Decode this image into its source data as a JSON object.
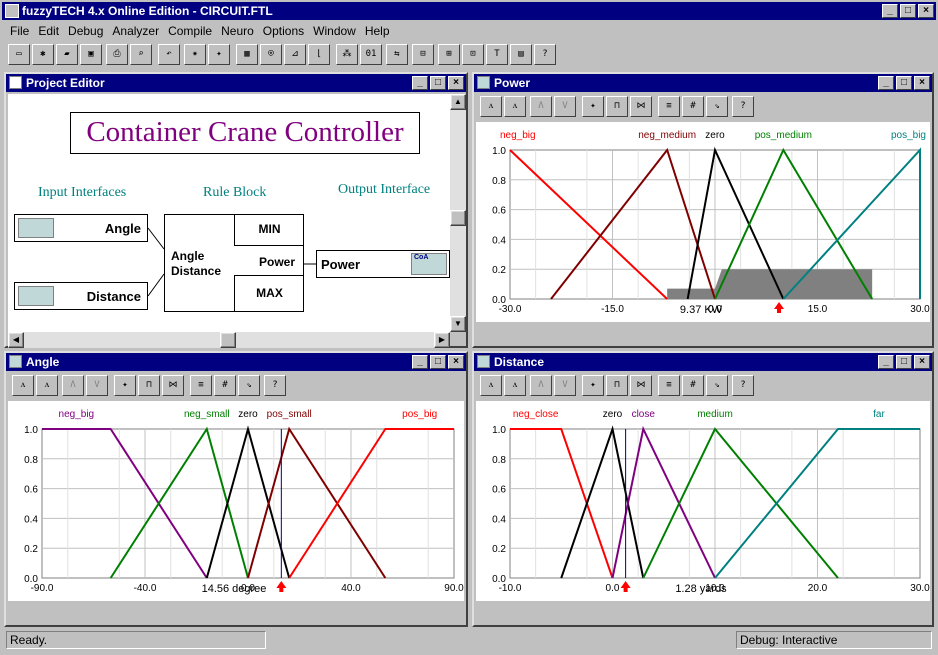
{
  "app": {
    "title": "fuzzyTECH 4.x Online Edition - CIRCUIT.FTL"
  },
  "menu": [
    "File",
    "Edit",
    "Debug",
    "Analyzer",
    "Compile",
    "Neuro",
    "Options",
    "Window",
    "Help"
  ],
  "toolbar_icons": [
    "new-file-icon",
    "open-wizard-icon",
    "open-folder-icon",
    "save-icon",
    "print-icon",
    "print-preview-icon",
    "undo-icon",
    "debug-icon",
    "analyzer-icon",
    "rule-block-icon",
    "variable-icon",
    "membership-icon",
    "transfer-plot-icon",
    "compile-icon",
    "binary-icon",
    "neuro-icon",
    "link-icon",
    "grid1-icon",
    "grid2-icon",
    "grid3-icon",
    "text-icon",
    "window-icon",
    "help-icon"
  ],
  "project_editor": {
    "title": "Project Editor",
    "heading": "Container Crane Controller",
    "input_label": "Input Interfaces",
    "rule_label": "Rule Block",
    "output_label": "Output Interface",
    "inputs": [
      "Angle",
      "Distance"
    ],
    "rule_inputs": [
      "Angle",
      "Distance"
    ],
    "aggregation": "MIN",
    "rule_output": "Power",
    "result_agg": "MAX",
    "output": "Power",
    "coa_label": "CoA"
  },
  "power": {
    "title": "Power",
    "unit_value": "9.37 KW",
    "chart": {
      "type": "line",
      "xlim": [
        -30,
        30
      ],
      "ylim": [
        0,
        1
      ],
      "xticks": [
        "-30.0",
        "-15.0",
        "0.0",
        "15.0",
        "30.0"
      ],
      "yticks": [
        "1.0",
        "0.8",
        "0.6",
        "0.4",
        "0.2",
        "0.0"
      ],
      "terms": [
        {
          "name": "neg_big",
          "color": "#ff0000",
          "points": [
            [
              -30,
              1
            ],
            [
              -7,
              0
            ]
          ]
        },
        {
          "name": "neg_medium",
          "color": "#800000",
          "points": [
            [
              -24,
              0
            ],
            [
              -7,
              1
            ],
            [
              0,
              0
            ]
          ]
        },
        {
          "name": "zero",
          "color": "#000000",
          "points": [
            [
              -4,
              0
            ],
            [
              0,
              1
            ],
            [
              10,
              0
            ]
          ]
        },
        {
          "name": "pos_medium",
          "color": "#008000",
          "points": [
            [
              0,
              0
            ],
            [
              10,
              1
            ],
            [
              23,
              0
            ]
          ]
        },
        {
          "name": "pos_big",
          "color": "#008080",
          "points": [
            [
              10,
              0
            ],
            [
              30,
              1
            ],
            [
              30,
              0
            ]
          ]
        }
      ],
      "fill": [
        [
          -7,
          0
        ],
        [
          -7,
          0.07
        ],
        [
          0,
          0.07
        ],
        [
          1,
          0.2
        ],
        [
          23,
          0.2
        ],
        [
          23,
          0
        ]
      ],
      "crisp": 9.37
    }
  },
  "angle": {
    "title": "Angle",
    "unit_value": "14.56 degree",
    "chart": {
      "type": "line",
      "xlim": [
        -90,
        90
      ],
      "ylim": [
        0,
        1
      ],
      "xticks": [
        "-90.0",
        "-40.0",
        "0.0",
        "40.0",
        "90.0"
      ],
      "yticks": [
        "1.0",
        "0.8",
        "0.6",
        "0.4",
        "0.2",
        "0.0"
      ],
      "terms": [
        {
          "name": "neg_big",
          "color": "#800080",
          "points": [
            [
              -90,
              1
            ],
            [
              -60,
              1
            ],
            [
              -18,
              0
            ]
          ]
        },
        {
          "name": "neg_small",
          "color": "#008000",
          "points": [
            [
              -60,
              0
            ],
            [
              -18,
              1
            ],
            [
              0,
              0
            ]
          ]
        },
        {
          "name": "zero",
          "color": "#000000",
          "points": [
            [
              -18,
              0
            ],
            [
              0,
              1
            ],
            [
              18,
              0
            ]
          ]
        },
        {
          "name": "pos_small",
          "color": "#800000",
          "points": [
            [
              0,
              0
            ],
            [
              18,
              1
            ],
            [
              60,
              0
            ]
          ]
        },
        {
          "name": "pos_big",
          "color": "#ff0000",
          "points": [
            [
              18,
              0
            ],
            [
              60,
              1
            ],
            [
              90,
              1
            ]
          ]
        }
      ],
      "crisp": 14.56
    }
  },
  "distance": {
    "title": "Distance",
    "unit_value": "1.28 yards",
    "chart": {
      "type": "line",
      "xlim": [
        -10,
        30
      ],
      "ylim": [
        0,
        1
      ],
      "xticks": [
        "-10.0",
        "0.0",
        "10.0",
        "20.0",
        "30.0"
      ],
      "yticks": [
        "1.0",
        "0.8",
        "0.6",
        "0.4",
        "0.2",
        "0.0"
      ],
      "terms": [
        {
          "name": "neg_close",
          "color": "#ff0000",
          "points": [
            [
              -10,
              1
            ],
            [
              -5,
              1
            ],
            [
              0,
              0
            ]
          ]
        },
        {
          "name": "zero",
          "color": "#000000",
          "points": [
            [
              -5,
              0
            ],
            [
              0,
              1
            ],
            [
              3,
              0
            ]
          ]
        },
        {
          "name": "close",
          "color": "#800080",
          "points": [
            [
              0,
              0
            ],
            [
              3,
              1
            ],
            [
              10,
              0
            ]
          ]
        },
        {
          "name": "medium",
          "color": "#008000",
          "points": [
            [
              3,
              0
            ],
            [
              10,
              1
            ],
            [
              22,
              0
            ]
          ]
        },
        {
          "name": "far",
          "color": "#008080",
          "points": [
            [
              10,
              0
            ],
            [
              22,
              1
            ],
            [
              30,
              1
            ]
          ]
        }
      ],
      "crisp": 1.28
    }
  },
  "status": {
    "left": "Ready.",
    "right": "Debug: Interactive"
  }
}
